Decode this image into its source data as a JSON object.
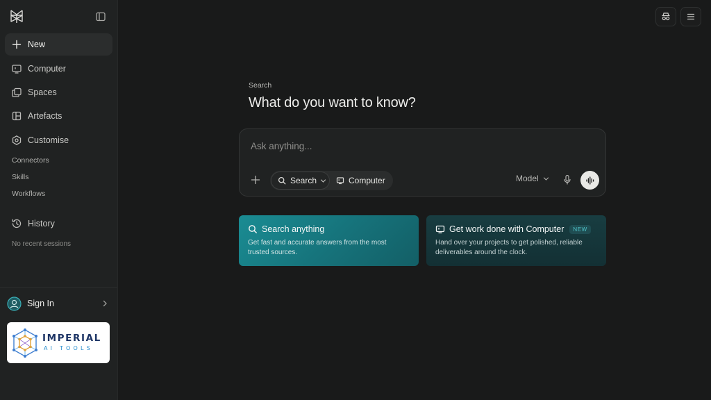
{
  "sidebar": {
    "nav": {
      "new": "New",
      "computer": "Computer",
      "spaces": "Spaces",
      "artefacts": "Artefacts",
      "customise": "Customise"
    },
    "sub": {
      "connectors": "Connectors",
      "skills": "Skills",
      "workflows": "Workflows"
    },
    "history": {
      "label": "History",
      "empty": "No recent sessions"
    },
    "sign_in": "Sign In",
    "brand": {
      "top": "IMPERIAL",
      "bottom": "AI TOOLS"
    }
  },
  "main": {
    "eyebrow": "Search",
    "headline": "What do you want to know?",
    "composer": {
      "placeholder": "Ask anything...",
      "mode_search": "Search",
      "mode_computer": "Computer",
      "model": "Model"
    },
    "cards": {
      "search": {
        "title": "Search anything",
        "desc": "Get fast and accurate answers from the most trusted sources."
      },
      "computer": {
        "title": "Get work done with Computer",
        "badge": "NEW",
        "desc": "Hand over your projects to get polished, reliable deliverables around the clock."
      }
    }
  },
  "colors": {
    "background": "#191a1a",
    "sidebar": "#202222",
    "accent_teal": "#1a8c93",
    "card_dark_teal": "#183d41",
    "badge_text": "#4fc3c9"
  },
  "icons": {
    "logo": "perplexity-logo-icon",
    "collapse": "sidebar-toggle-icon",
    "new": "plus-icon",
    "computer": "monitor-icon",
    "spaces": "stack-icon",
    "artefacts": "layout-icon",
    "customise": "hexagon-icon",
    "history": "history-icon",
    "sign_in": "user-circle-icon",
    "incognito": "incognito-icon",
    "menu": "menu-icon",
    "mic": "microphone-icon",
    "voice": "waveform-icon"
  }
}
